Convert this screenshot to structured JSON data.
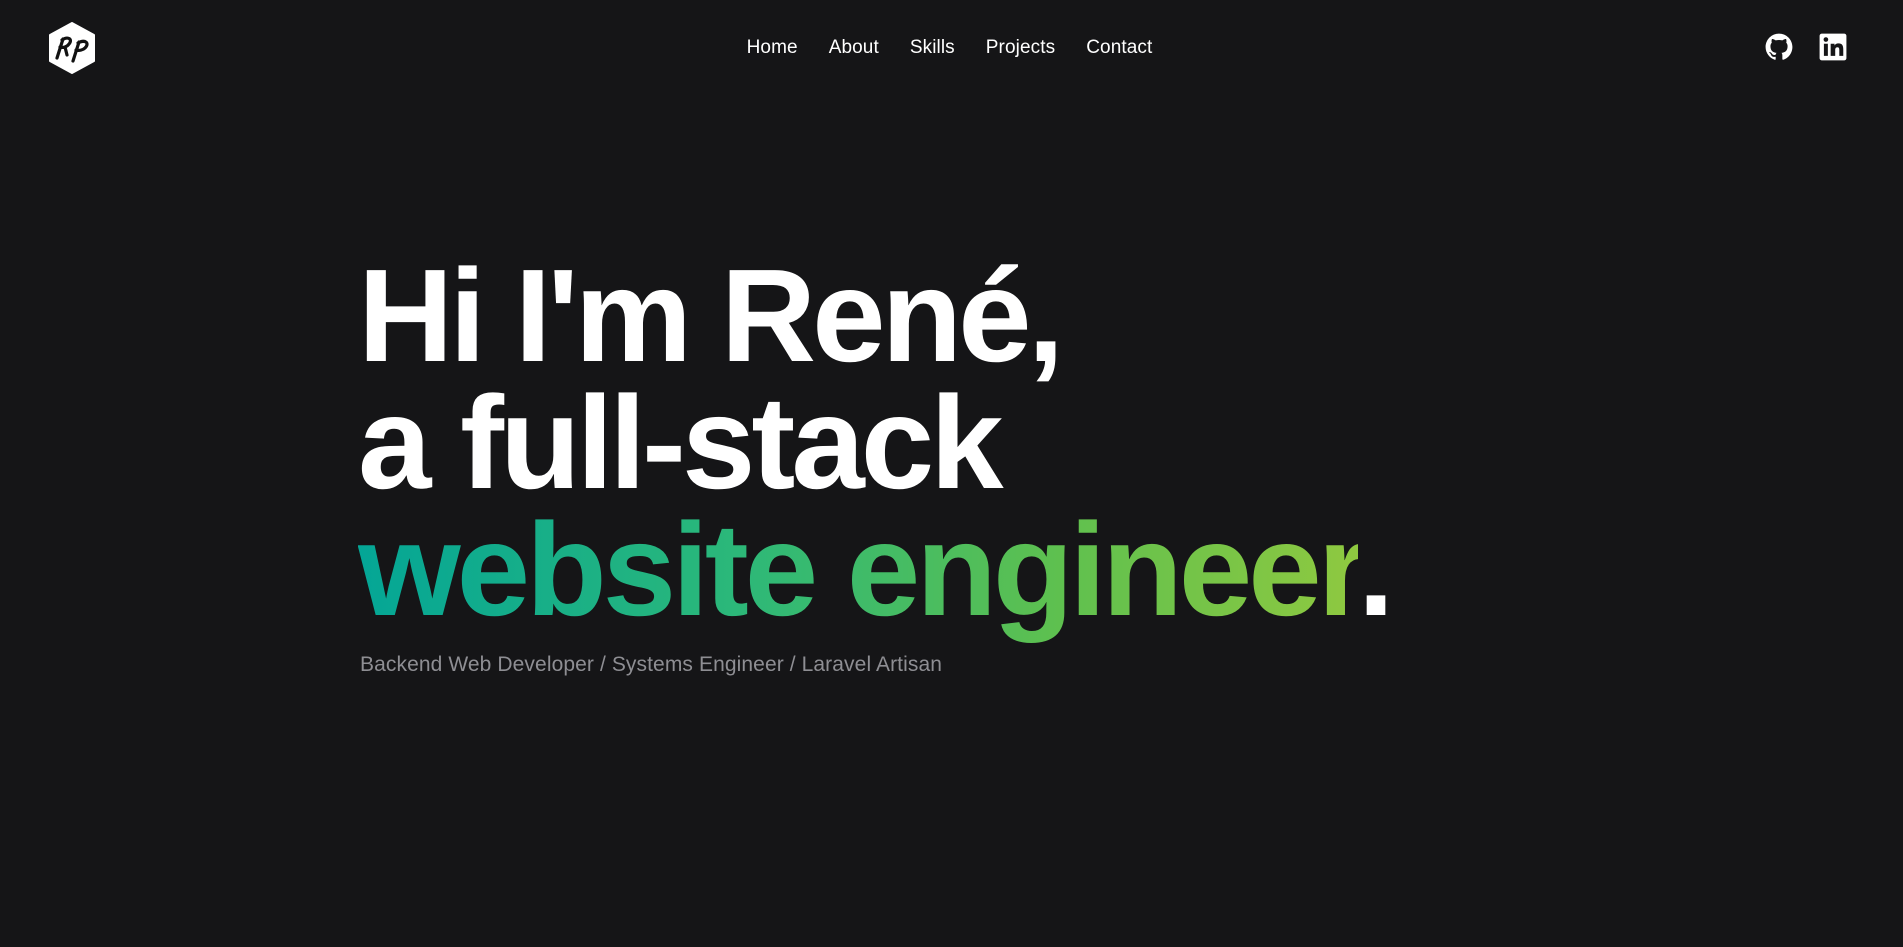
{
  "brand": {
    "logo_text": "RP",
    "logo_icon": "rp-hexagon-logo"
  },
  "nav": {
    "items": [
      {
        "label": "Home"
      },
      {
        "label": "About"
      },
      {
        "label": "Skills"
      },
      {
        "label": "Projects"
      },
      {
        "label": "Contact"
      }
    ]
  },
  "social": {
    "github_icon": "github-icon",
    "linkedin_icon": "linkedin-icon"
  },
  "hero": {
    "line1": "Hi I'm René,",
    "line2": "a full-stack",
    "line3_highlight": "website engineer",
    "line3_punct": ".",
    "subtitle": "Backend Web Developer / Systems Engineer / Laravel Artisan"
  },
  "colors": {
    "background": "#151517",
    "text": "#ffffff",
    "subtitle": "#8e8e93",
    "gradient_start": "#04a696",
    "gradient_end": "#8fc940"
  }
}
